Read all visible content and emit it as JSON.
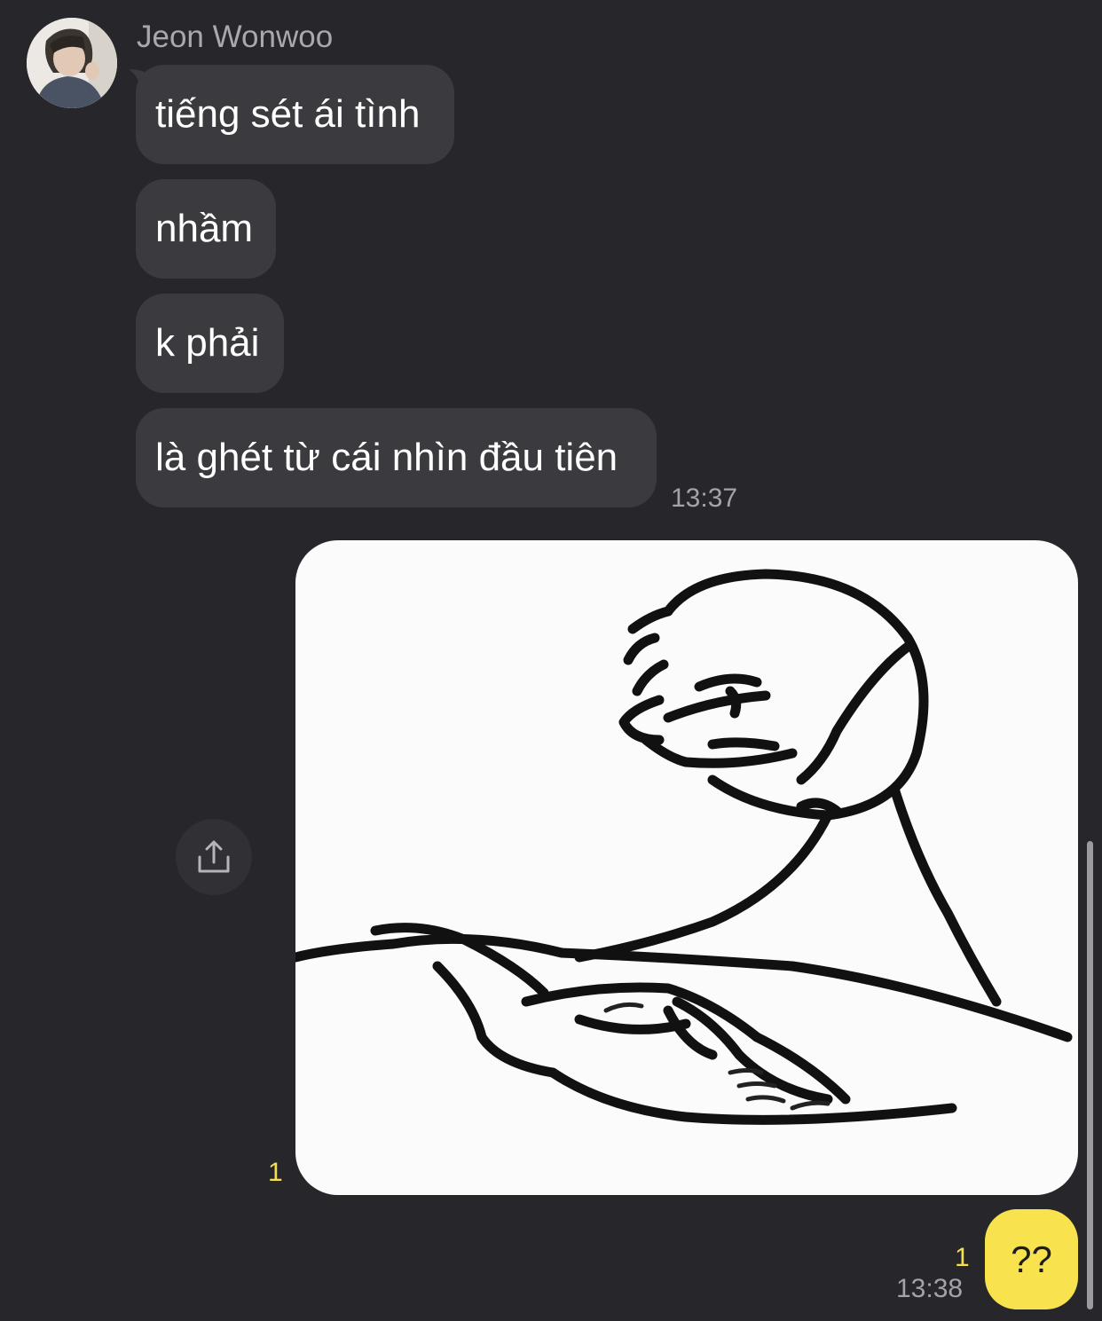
{
  "chat": {
    "sender_name": "Jeon Wonwoo",
    "incoming_messages": [
      "tiếng sét ái tình",
      "nhầm",
      "k phải",
      "là ghét từ cái nhìn đầu tiên"
    ],
    "incoming_time": "13:37",
    "outgoing_image_read_count": "1",
    "outgoing_text": "??",
    "outgoing_text_read_count": "1",
    "outgoing_time": "13:38"
  },
  "icons": {
    "share": "share-icon",
    "avatar": "avatar"
  },
  "colors": {
    "background": "#27272b",
    "incoming_bubble": "#3a3a3f",
    "outgoing_bubble": "#f8e34e",
    "read_count": "#f7df4a",
    "timestamp": "#a3a3a8"
  }
}
